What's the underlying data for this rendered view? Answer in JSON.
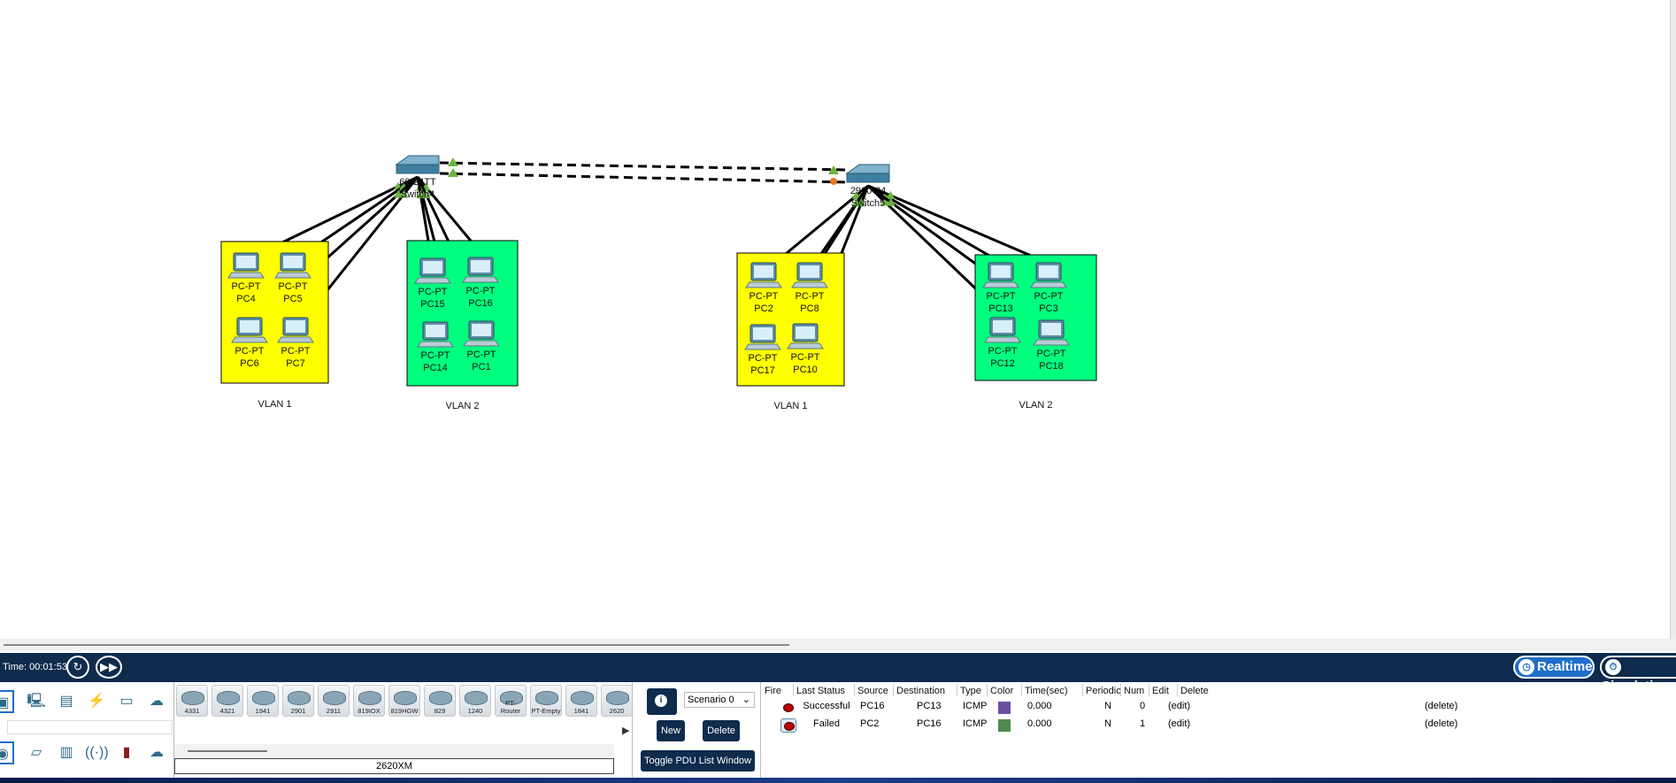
{
  "workspace": {
    "switches": [
      {
        "model": "2960-24TT",
        "name": "Switch4",
        "visible_model": "60-24TT"
      },
      {
        "model": "2960-24TT",
        "name": "Switch5",
        "visible_model": "2960-24"
      }
    ],
    "areas": [
      {
        "label": "VLAN 1",
        "color": "#ffff00",
        "pcs": [
          [
            "PC-PT",
            "PC4"
          ],
          [
            "PC-PT",
            "PC5"
          ],
          [
            "PC-PT",
            "PC6"
          ],
          [
            "PC-PT",
            "PC7"
          ]
        ]
      },
      {
        "label": "VLAN 2",
        "color": "#00ff7f",
        "pcs": [
          [
            "PC-PT",
            "PC15"
          ],
          [
            "PC-PT",
            "PC16"
          ],
          [
            "PC-PT",
            "PC14"
          ],
          [
            "PC-PT",
            "PC1"
          ]
        ]
      },
      {
        "label": "VLAN 1",
        "color": "#ffff00",
        "pcs": [
          [
            "PC-PT",
            "PC2"
          ],
          [
            "PC-PT",
            "PC8"
          ],
          [
            "PC-PT",
            "PC17"
          ],
          [
            "PC-PT",
            "PC10"
          ]
        ]
      },
      {
        "label": "VLAN 2",
        "color": "#00ff7f",
        "pcs": [
          [
            "PC-PT",
            "PC13"
          ],
          [
            "PC-PT",
            "PC3"
          ],
          [
            "PC-PT",
            "PC12"
          ],
          [
            "PC-PT",
            "PC18"
          ]
        ]
      }
    ],
    "link_colors": {
      "up": "#6db33f",
      "down": "#e87722",
      "cable": "#000000"
    }
  },
  "toolbar": {
    "time": "Time: 00:01:53",
    "realtime_label": "Realtime",
    "simulation_label": "Simulation"
  },
  "categories": {
    "top_icons": [
      "network-devices-icon",
      "end-devices-icon",
      "components-icon",
      "connections-icon",
      "miscellaneous-icon",
      "multiuser-icon"
    ],
    "bottom_icons": [
      "routers-icon",
      "switches-icon",
      "hubs-icon",
      "wireless-devices-icon",
      "security-icon",
      "wan-emulation-icon"
    ]
  },
  "devices": {
    "tiles": [
      "4331",
      "4321",
      "1941",
      "2901",
      "2911",
      "819IOX",
      "819HGW",
      "829",
      "1240",
      "PT-Router",
      "PT-Empty",
      "1841",
      "2620"
    ],
    "selected": "2620XM"
  },
  "scenario": {
    "select_value": "Scenario 0",
    "new_label": "New",
    "delete_label": "Delete",
    "toggle_label": "Toggle PDU List Window"
  },
  "pdu": {
    "headers": [
      "Fire",
      "Last Status",
      "Source",
      "Destination",
      "Type",
      "Color",
      "Time(sec)",
      "Periodic",
      "Num",
      "Edit",
      "Delete"
    ],
    "rows": [
      {
        "status": "Successful",
        "source": "PC16",
        "destination": "PC13",
        "type": "ICMP",
        "color": "#6a4fa0",
        "time": "0.000",
        "periodic": "N",
        "num": "0",
        "edit": "(edit)",
        "delete": "(delete)"
      },
      {
        "status": "Failed",
        "source": "PC2",
        "destination": "PC16",
        "type": "ICMP",
        "color": "#4f8a4f",
        "time": "0.000",
        "periodic": "N",
        "num": "1",
        "edit": "(edit)",
        "delete": "(delete)"
      }
    ]
  }
}
